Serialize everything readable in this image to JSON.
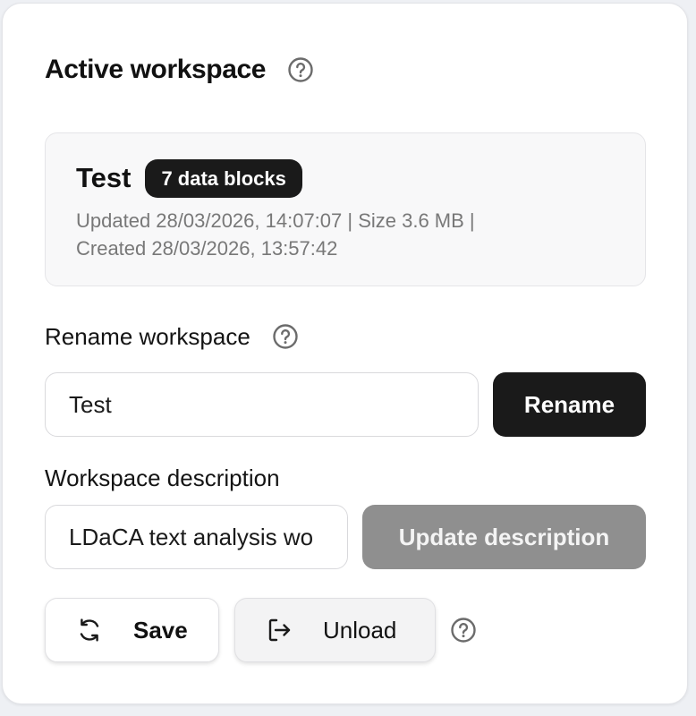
{
  "header": {
    "title": "Active workspace",
    "help_icon": "help-circle-icon"
  },
  "workspace": {
    "name": "Test",
    "badge": "7 data blocks",
    "meta_line1": "Updated 28/03/2026, 14:07:07 | Size 3.6 MB |",
    "meta_line2": "Created 28/03/2026, 13:57:42"
  },
  "rename": {
    "label": "Rename workspace",
    "value": "Test",
    "button": "Rename"
  },
  "description": {
    "label": "Workspace description",
    "value": "LDaCA text analysis wo",
    "button": "Update description"
  },
  "actions": {
    "save": "Save",
    "save_icon": "refresh-icon",
    "unload": "Unload",
    "unload_icon": "log-out-icon"
  },
  "colors": {
    "primary": "#1a1a1a",
    "disabled": "#8f8f8f",
    "muted_text": "#787878"
  }
}
